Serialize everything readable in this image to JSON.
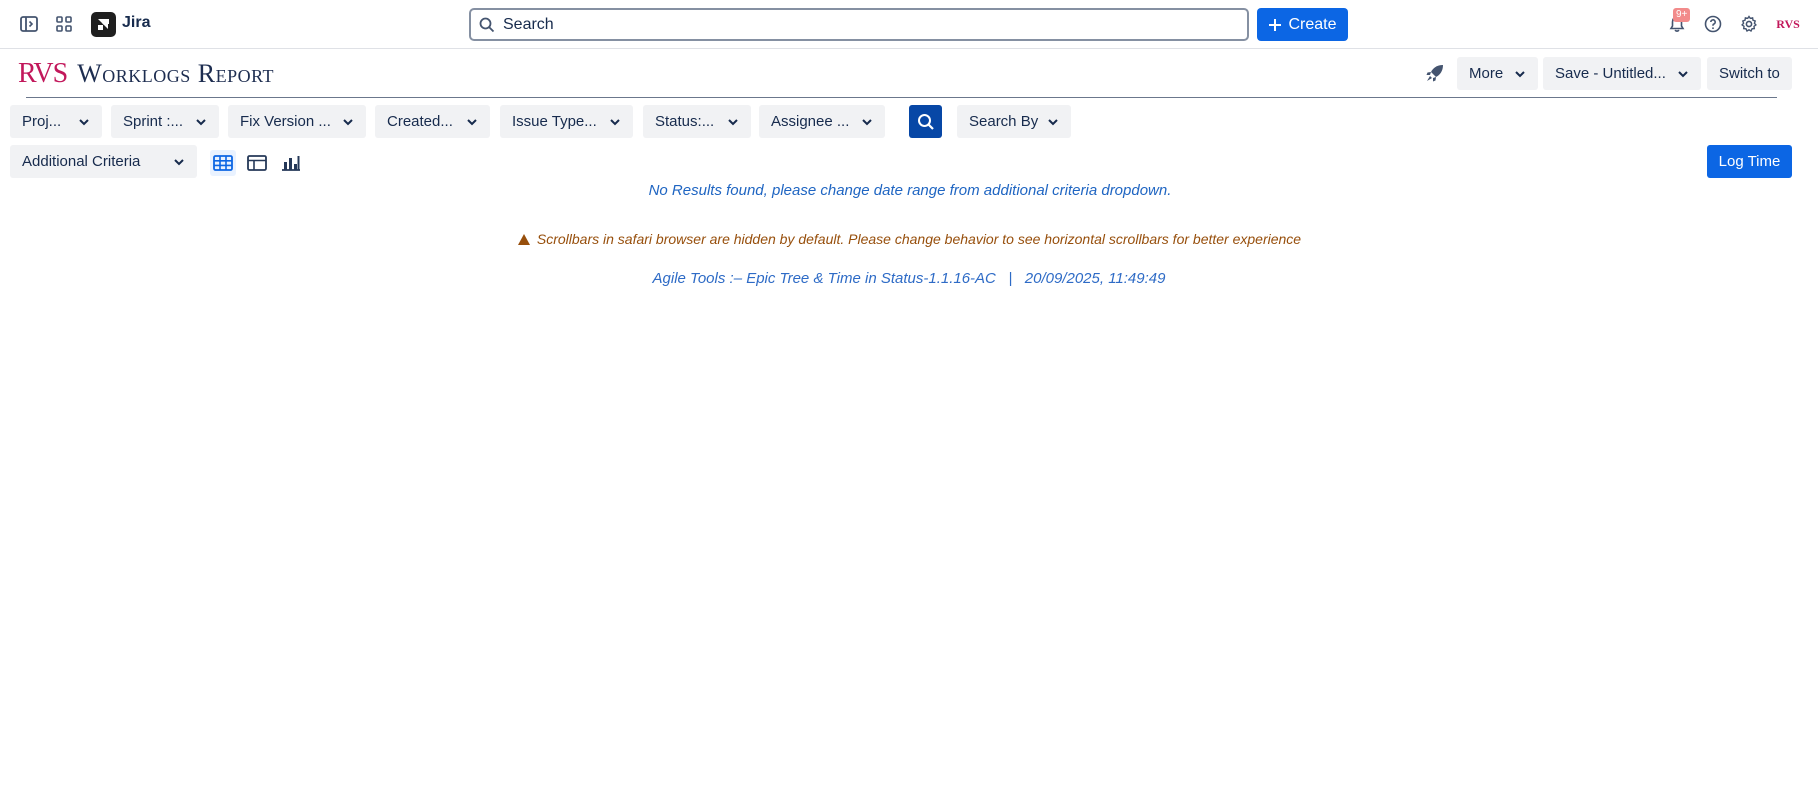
{
  "topnav": {
    "app_name": "Jira",
    "search_placeholder": "Search",
    "create_label": "Create",
    "notifications_badge": "9+",
    "avatar_text": "RVS"
  },
  "header": {
    "logo_text": "RVS",
    "title": "Worklogs Report",
    "more_label": "More",
    "save_label": "Save - Untitled...",
    "switch_label": "Switch to"
  },
  "filters": [
    {
      "label": "Proj..."
    },
    {
      "label": "Sprint :..."
    },
    {
      "label": "Fix Version ..."
    },
    {
      "label": "Created..."
    },
    {
      "label": "Issue Type..."
    },
    {
      "label": "Status:..."
    },
    {
      "label": "Assignee ..."
    }
  ],
  "search_by_label": "Search By",
  "additional_criteria_label": "Additional Criteria",
  "log_time_label": "Log Time",
  "messages": {
    "no_results": "No Results found, please change date range from additional criteria dropdown.",
    "safari_warning": "Scrollbars in safari browser are hidden by default. Please change behavior to see horizontal scrollbars for better experience",
    "footer": "Agile Tools :– Epic Tree & Time in Status-1.1.16-AC   |   20/09/2025, 11:49:49"
  },
  "colors": {
    "primary": "#0c66e4",
    "search_button": "#0747a6",
    "info_text": "#1f65c2",
    "warning_text": "#974f0c",
    "logo_accent": "#c2185b"
  },
  "icons": [
    "sidebar-toggle-icon",
    "app-switcher-icon",
    "jira-logo-icon",
    "search-icon",
    "plus-icon",
    "bell-icon",
    "help-icon",
    "gear-icon",
    "rocket-icon",
    "chevron-down-icon",
    "grid-view-icon",
    "table-view-icon",
    "chart-view-icon",
    "warning-icon"
  ]
}
